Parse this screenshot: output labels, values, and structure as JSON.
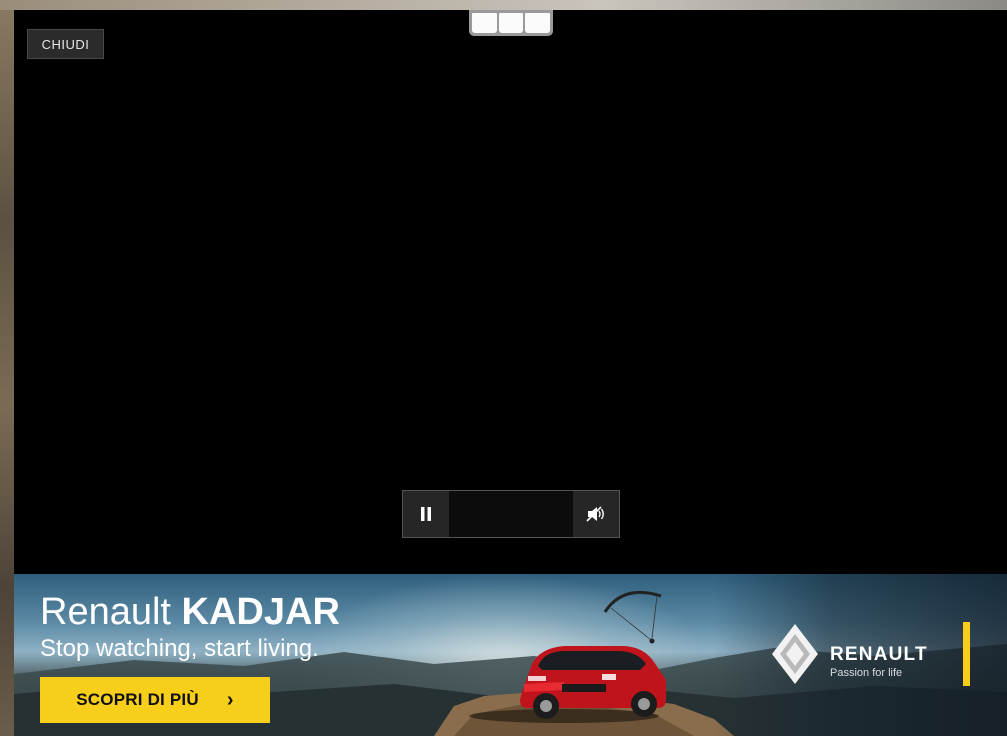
{
  "player": {
    "close_label": "CHIUDI",
    "tabs": [
      {
        "name": "tab-1"
      },
      {
        "name": "tab-2"
      },
      {
        "name": "tab-3"
      }
    ],
    "controls": {
      "play_pause_icon": "pause-icon",
      "volume_icon": "mute-icon"
    }
  },
  "banner": {
    "brand_word": "Renault",
    "model": "KADJAR",
    "tagline": "Stop watching, start living.",
    "cta_label": "SCOPRI DI PIÙ",
    "cta_icon": "chevron-right-icon",
    "brand_name": "RENAULT",
    "brand_tagline": "Passion for life",
    "accent_color": "#f7cf1b"
  }
}
